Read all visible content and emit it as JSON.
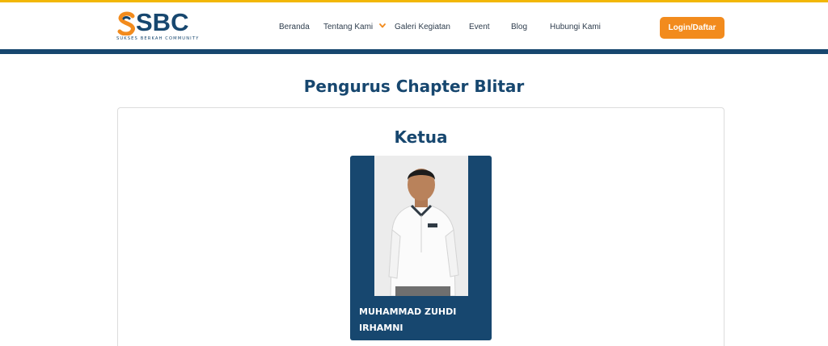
{
  "brand": {
    "logo_text": "SBC",
    "tagline": "SUKSES BERKAH COMMUNITY"
  },
  "nav": {
    "items": [
      {
        "label": "Beranda"
      },
      {
        "label": "Tentang Kami",
        "has_dropdown": true
      },
      {
        "label": "Galeri Kegiatan"
      },
      {
        "label": "Event"
      },
      {
        "label": "Blog"
      },
      {
        "label": "Hubungi Kami"
      }
    ],
    "login_label": "Login/Daftar"
  },
  "page": {
    "title": "Pengurus Chapter Blitar"
  },
  "section": {
    "heading": "Ketua",
    "members": [
      {
        "name": "MUHAMMAD ZUHDI IRHAMNI",
        "photo_icon": "person-photo"
      }
    ]
  },
  "colors": {
    "brand_blue": "#17476f",
    "accent_orange": "#f28b1d",
    "top_strip": "#f2b705"
  },
  "icons": {
    "dropdown": "chevron-down-icon",
    "logo": "sbc-logo-mark"
  }
}
